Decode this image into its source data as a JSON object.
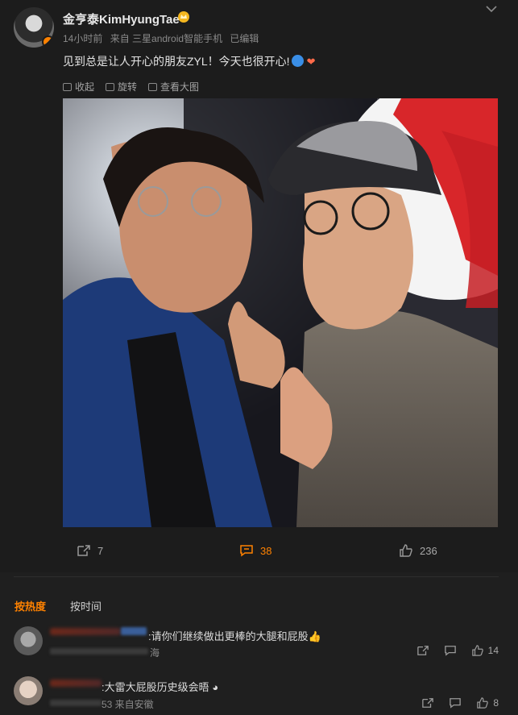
{
  "post": {
    "username": "金亨泰KimHyungTae",
    "meta": {
      "time": "14小时前",
      "source": "来自 三星android智能手机",
      "edited": "已编辑"
    },
    "content": "见到总是让人开心的朋友ZYL！今天也很开心!",
    "tools": {
      "collapse": "收起",
      "rotate": "旋转",
      "view_large": "查看大图"
    },
    "actions": {
      "reposts": "7",
      "comments": "38",
      "likes": "236"
    }
  },
  "comments_section": {
    "sort_hot": "按热度",
    "sort_time": "按时间",
    "items": [
      {
        "text": ":请你们继续做出更棒的大腿和屁股",
        "meta_visible": "海",
        "likes": "14"
      },
      {
        "text": ":大雷大屁股历史级会晤",
        "meta_visible": "53 来自安徽",
        "likes": "8"
      }
    ]
  },
  "colors": {
    "accent": "#ff8200",
    "background": "#1f1f1f",
    "text": "#d6d6d6"
  }
}
